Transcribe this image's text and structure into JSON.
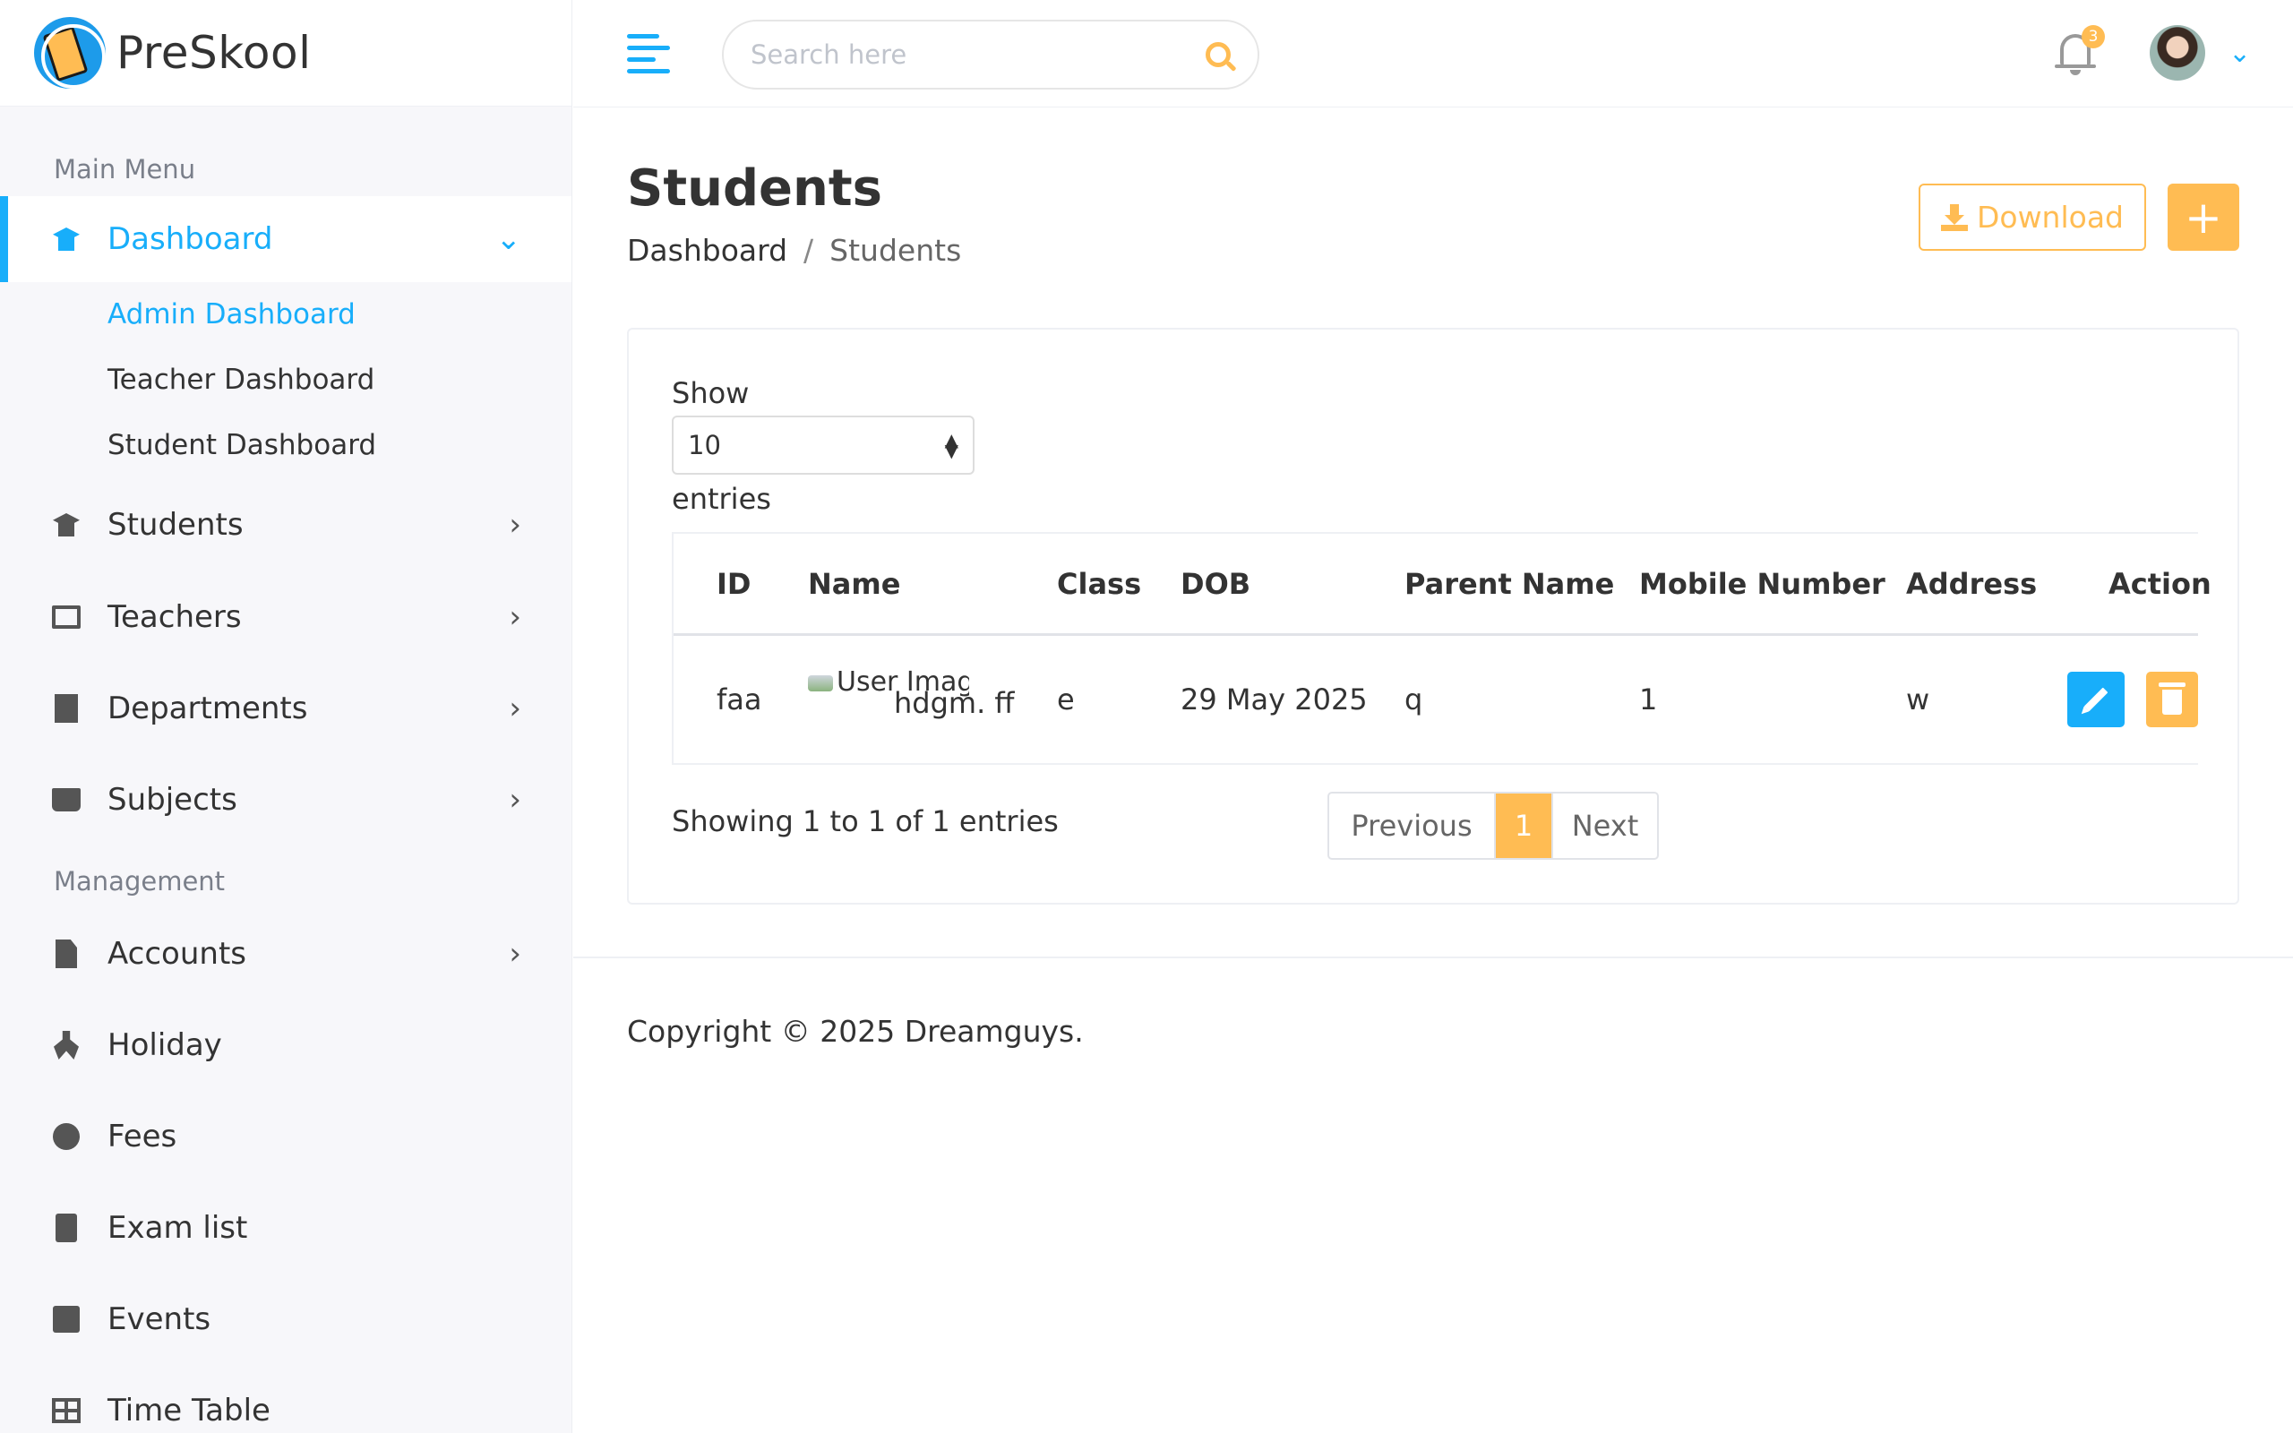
{
  "app": {
    "name": "PreSkool"
  },
  "sidebar": {
    "main_menu_title": "Main Menu",
    "management_title": "Management",
    "dashboard": {
      "label": "Dashboard",
      "sub": [
        "Admin Dashboard",
        "Teacher Dashboard",
        "Student Dashboard"
      ]
    },
    "items": [
      {
        "label": "Students",
        "icon": "graduation-cap-icon"
      },
      {
        "label": "Teachers",
        "icon": "chalkboard-teacher-icon"
      },
      {
        "label": "Departments",
        "icon": "building-icon"
      },
      {
        "label": "Subjects",
        "icon": "book-reader-icon"
      }
    ],
    "management_items": [
      {
        "label": "Accounts",
        "icon": "file-invoice-dollar-icon"
      },
      {
        "label": "Holiday",
        "icon": "holiday-icon"
      },
      {
        "label": "Fees",
        "icon": "comment-dollar-icon"
      },
      {
        "label": "Exam list",
        "icon": "clipboard-list-icon"
      },
      {
        "label": "Events",
        "icon": "calendar-icon"
      },
      {
        "label": "Time Table",
        "icon": "table-icon"
      }
    ]
  },
  "header": {
    "search_placeholder": "Search here",
    "notification_count": "3"
  },
  "page": {
    "title": "Students",
    "breadcrumb_home": "Dashboard",
    "breadcrumb_sep": "/",
    "breadcrumb_current": "Students",
    "download_label": "Download",
    "add_label": "+"
  },
  "table": {
    "show_label": "Show",
    "entries_value": "10",
    "entries_label": "entries",
    "columns": [
      "ID",
      "Name",
      "Class",
      "DOB",
      "Parent Name",
      "Mobile Number",
      "Address",
      "Action"
    ],
    "rows": [
      {
        "id": "faa",
        "image_alt": "User Image",
        "name": "hdgm. ff",
        "class": "e",
        "dob": "29 May 2025",
        "parent": "q",
        "mobile": "1",
        "address": "w"
      }
    ],
    "showing_text": "Showing 1 to 1 of 1 entries",
    "pager": {
      "prev": "Previous",
      "current": "1",
      "next": "Next"
    }
  },
  "footer": {
    "copyright": "Copyright © 2025 Dreamguys."
  },
  "colors": {
    "accent": "#18aefa",
    "warning": "#ffbc53"
  }
}
